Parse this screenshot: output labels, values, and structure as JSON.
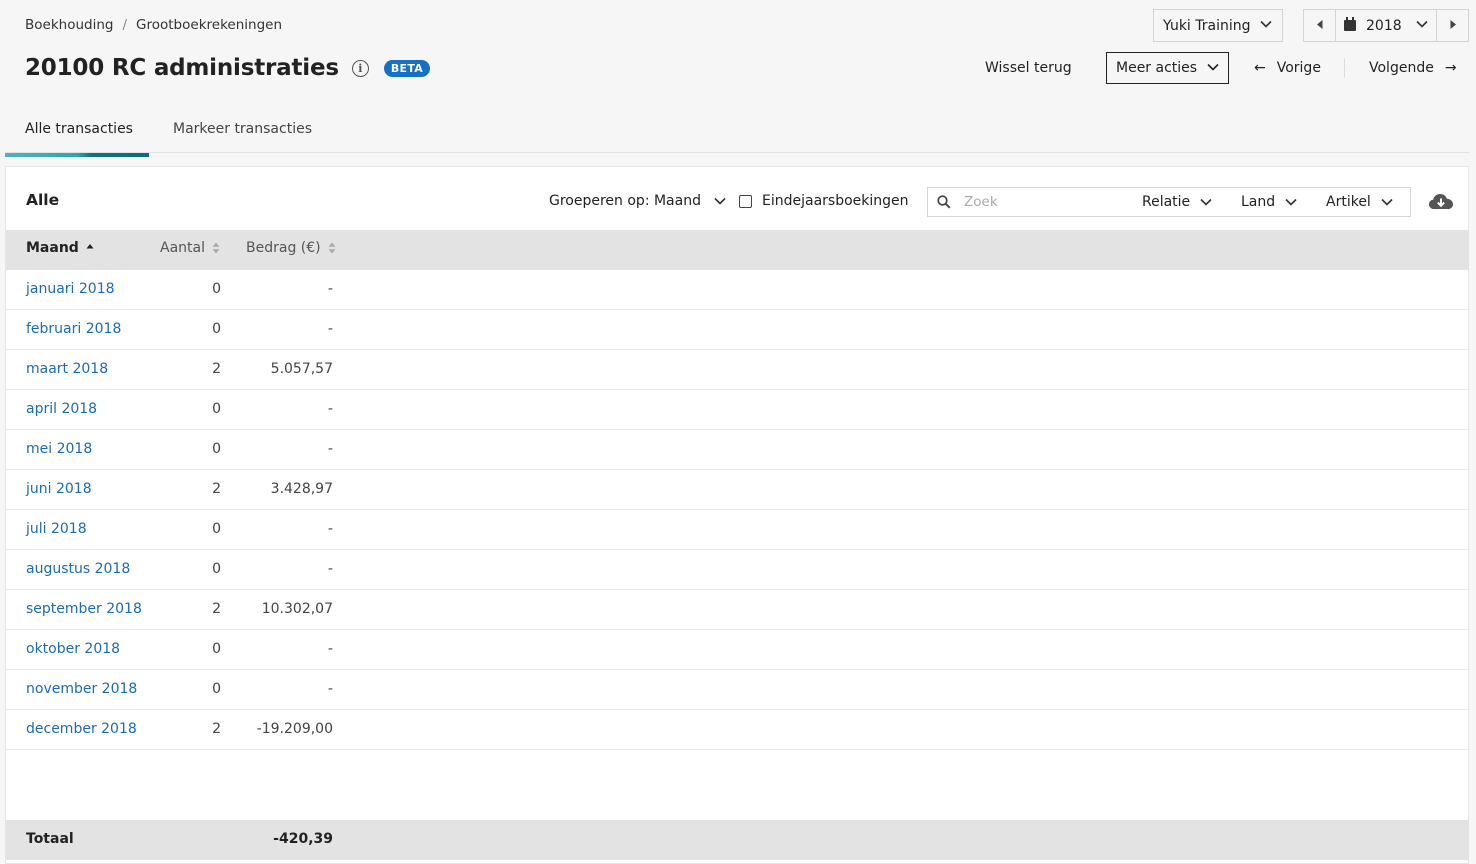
{
  "breadcrumb": {
    "root": "Boekhouding",
    "separator": "/",
    "current": "Grootboekrekeningen"
  },
  "header": {
    "title": "20100 RC administraties",
    "info_glyph": "i",
    "badge": "BETA"
  },
  "company_select": {
    "value": "Yuki Training"
  },
  "year_select": {
    "value": "2018"
  },
  "actions": {
    "wissel_terug": "Wissel terug",
    "meer_acties": "Meer acties",
    "vorige": "Vorige",
    "volgende": "Volgende",
    "prev_arrow": "←",
    "next_arrow": "→"
  },
  "tabs": [
    {
      "label": "Alle transacties",
      "active": true
    },
    {
      "label": "Markeer transacties",
      "active": false
    }
  ],
  "panel": {
    "title": "Alle",
    "group_by": "Groeperen op: Maand",
    "checkbox_label": "Eindejaarsboekingen",
    "checkbox_checked": false,
    "search_placeholder": "Zoek",
    "filters": [
      "Relatie",
      "Land",
      "Artikel"
    ]
  },
  "table": {
    "columns": [
      "Maand",
      "Aantal",
      "Bedrag (€)"
    ],
    "rows": [
      {
        "month": "januari 2018",
        "count": "0",
        "amount": "-"
      },
      {
        "month": "februari 2018",
        "count": "0",
        "amount": "-"
      },
      {
        "month": "maart 2018",
        "count": "2",
        "amount": "5.057,57"
      },
      {
        "month": "april 2018",
        "count": "0",
        "amount": "-"
      },
      {
        "month": "mei 2018",
        "count": "0",
        "amount": "-"
      },
      {
        "month": "juni 2018",
        "count": "2",
        "amount": "3.428,97"
      },
      {
        "month": "juli 2018",
        "count": "0",
        "amount": "-"
      },
      {
        "month": "augustus 2018",
        "count": "0",
        "amount": "-"
      },
      {
        "month": "september 2018",
        "count": "2",
        "amount": "10.302,07"
      },
      {
        "month": "oktober 2018",
        "count": "0",
        "amount": "-"
      },
      {
        "month": "november 2018",
        "count": "0",
        "amount": "-"
      },
      {
        "month": "december 2018",
        "count": "2",
        "amount": "-19.209,00"
      }
    ],
    "footer": {
      "label": "Totaal",
      "total": "-420,39"
    }
  },
  "colors": {
    "link": "#1b6bb5",
    "badge": "#1570c6",
    "tab_accent": "#0b6b80",
    "header_bg": "#e3e3e3"
  }
}
